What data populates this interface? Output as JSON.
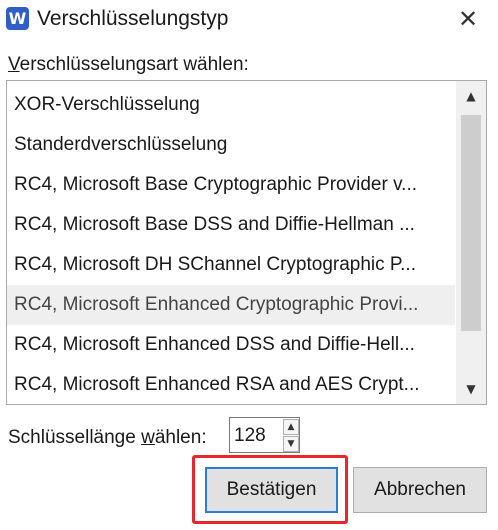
{
  "window": {
    "icon_letter": "W",
    "title": "Verschlüsselungstyp",
    "close_glyph": "✕"
  },
  "list": {
    "label_prefix": "",
    "label_mnemonic": "V",
    "label_rest": "erschlüsselungsart wählen:",
    "items": [
      "XOR-Verschlüsselung",
      "Standerdverschlüsselung",
      "RC4, Microsoft Base Cryptographic Provider v...",
      "RC4, Microsoft Base DSS and Diffie-Hellman ...",
      "RC4, Microsoft DH SChannel Cryptographic P...",
      "RC4, Microsoft Enhanced Cryptographic Provi...",
      "RC4, Microsoft Enhanced DSS and Diffie-Hell...",
      "RC4, Microsoft Enhanced RSA and AES Crypt..."
    ],
    "hovered_index": 5,
    "scroll_up_glyph": "▲",
    "scroll_down_glyph": "▼"
  },
  "key_length": {
    "label_prefix": "Schlüssellänge ",
    "label_mnemonic": "w",
    "label_rest": "ählen:",
    "value": "128",
    "spin_up_glyph": "▲",
    "spin_down_glyph": "▼"
  },
  "buttons": {
    "confirm": "Bestätigen",
    "cancel": "Abbrechen"
  },
  "colors": {
    "highlight": "#e8262c",
    "focus": "#2c7dd6",
    "app_icon": "#2f5ec9"
  }
}
